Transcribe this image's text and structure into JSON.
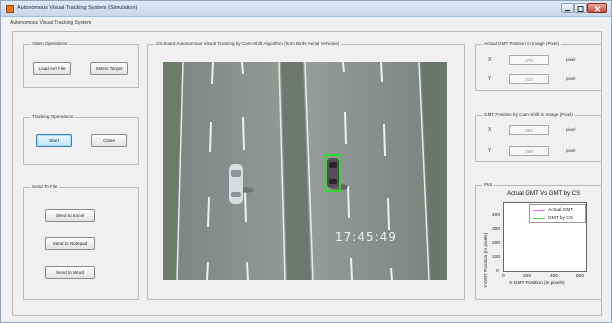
{
  "window": {
    "title": "Autonomous Visual Tracking System (Simulation)"
  },
  "client_title": "Autonomous Visual Tracking System",
  "video_operations": {
    "label": "Video Operations",
    "load_button": "Load AVI File",
    "select_button": "Select Target"
  },
  "tracking_operations": {
    "label": "Tracking Operations",
    "start_button": "Start",
    "close_button": "Close"
  },
  "send_to_file": {
    "label": "Send To File",
    "excel_button": "Send to Excel",
    "notepad_button": "Send to Notepad",
    "word_button": "Send to Word"
  },
  "video_panel": {
    "label": "On-board Autonomous Visual Tracking by Cam-Shift Algorithm (from Birds Aerial Vehicles)",
    "timestamp": "17:45:49"
  },
  "actual_position": {
    "label": "Actual GMT Position in Image (Pixel)",
    "x_label": "X",
    "x_value": "376",
    "y_label": "Y",
    "y_value": "314",
    "unit": "pixel"
  },
  "camshift_position": {
    "label": "GMT Position by Cam-Shift in Image (Pixel)",
    "x_label": "X",
    "x_value": "381",
    "y_label": "Y",
    "y_value": "306",
    "unit": "pixel"
  },
  "plot_panel": {
    "label": "Plot",
    "title": "Actual GMT Vs GMT by CS",
    "xlabel": "X-GMT Position (in pixels)",
    "ylabel": "Y-GMT Position (in pixels)",
    "x_ticks": [
      "0",
      "200",
      "400",
      "600"
    ],
    "y_ticks": [
      "0",
      "100",
      "200",
      "300",
      "400"
    ],
    "legend": [
      "Actual GMT",
      "GMT by CS"
    ],
    "legend_colors": [
      "#ff66ff",
      "#33dd33"
    ]
  }
}
